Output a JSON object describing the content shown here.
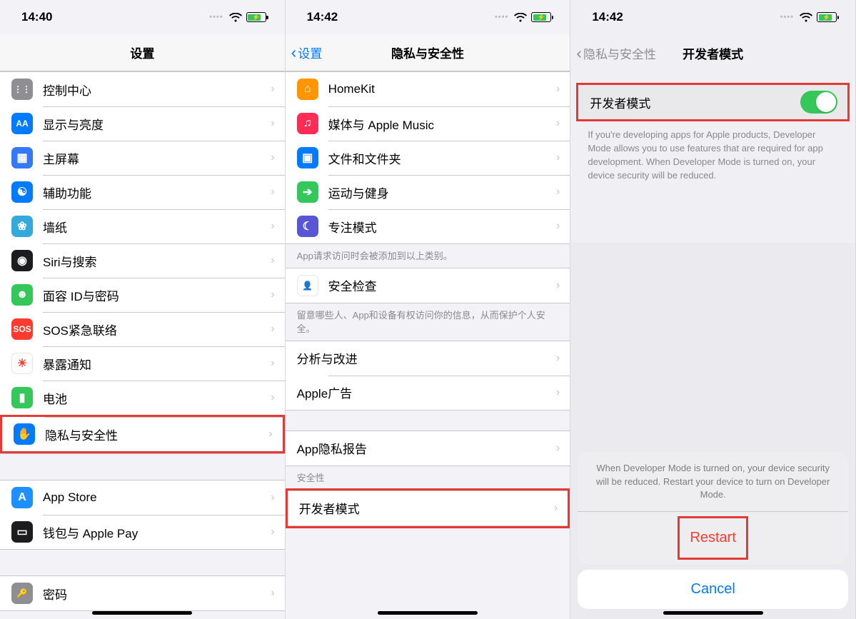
{
  "pane1": {
    "status_time": "14:40",
    "nav_title": "设置",
    "groups": [
      {
        "type": "cells",
        "cells": [
          {
            "icon": "control-center-icon",
            "bg": "bg-gray",
            "glyph": "⋮⋮",
            "label": "控制中心"
          },
          {
            "icon": "display-icon",
            "bg": "bg-blue",
            "glyph": "AA",
            "label": "显示与亮度"
          },
          {
            "icon": "home-screen-icon",
            "bg": "bg-apps",
            "glyph": "▦",
            "label": "主屏幕"
          },
          {
            "icon": "accessibility-icon",
            "bg": "bg-access",
            "glyph": "☯",
            "label": "辅助功能"
          },
          {
            "icon": "wallpaper-icon",
            "bg": "bg-wall",
            "glyph": "❀",
            "label": "墙纸"
          },
          {
            "icon": "siri-icon",
            "bg": "bg-siri",
            "glyph": "◉",
            "label": "Siri与搜索"
          },
          {
            "icon": "faceid-icon",
            "bg": "bg-faceid",
            "glyph": "☻",
            "label": "面容 ID与密码"
          },
          {
            "icon": "sos-icon",
            "bg": "bg-sos",
            "glyph": "SOS",
            "label": "SOS紧急联络"
          },
          {
            "icon": "exposure-icon",
            "bg": "bg-expose",
            "glyph": "☀",
            "label": "暴露通知"
          },
          {
            "icon": "battery-icon",
            "bg": "bg-battery",
            "glyph": "▮",
            "label": "电池"
          },
          {
            "icon": "privacy-icon",
            "bg": "bg-privacy",
            "glyph": "✋",
            "label": "隐私与安全性",
            "highlight": true
          }
        ]
      },
      {
        "type": "gap"
      },
      {
        "type": "cells",
        "cells": [
          {
            "icon": "appstore-icon",
            "bg": "bg-appstore",
            "glyph": "A",
            "label": "App Store"
          },
          {
            "icon": "wallet-icon",
            "bg": "bg-wallet",
            "glyph": "▭",
            "label": "钱包与 Apple Pay"
          }
        ]
      },
      {
        "type": "gap"
      },
      {
        "type": "cells",
        "cells": [
          {
            "icon": "passwords-icon",
            "bg": "bg-passwords",
            "glyph": "🔑",
            "label": "密码"
          }
        ]
      }
    ]
  },
  "pane2": {
    "status_time": "14:42",
    "nav_back": "设置",
    "nav_title": "隐私与安全性",
    "sections": [
      {
        "type": "cells",
        "cells": [
          {
            "icon": "homekit-icon",
            "bg": "bg-orange",
            "glyph": "⌂",
            "label": "HomeKit"
          },
          {
            "icon": "music-icon",
            "bg": "bg-red",
            "glyph": "♫",
            "label": "媒体与 Apple Music"
          },
          {
            "icon": "files-icon",
            "bg": "bg-folder",
            "glyph": "▣",
            "label": "文件和文件夹"
          },
          {
            "icon": "fitness-icon",
            "bg": "bg-health",
            "glyph": "➔",
            "label": "运动与健身"
          },
          {
            "icon": "focus-icon",
            "bg": "bg-focus",
            "glyph": "☾",
            "label": "专注模式"
          }
        ],
        "footer": "App请求访问时会被添加到以上类别。"
      },
      {
        "type": "cells",
        "cells": [
          {
            "icon": "safety-check-icon",
            "bg": "bg-safetycheck",
            "glyph": "👤",
            "label": "安全检查"
          }
        ],
        "footer": "留意哪些人、App和设备有权访问你的信息，从而保护个人安全。"
      },
      {
        "type": "cells-noicon",
        "cells": [
          {
            "label": "分析与改进"
          },
          {
            "label": "Apple广告"
          }
        ]
      },
      {
        "type": "gap"
      },
      {
        "type": "cells-noicon",
        "cells": [
          {
            "label": "App隐私报告"
          }
        ]
      },
      {
        "type": "header",
        "text": "安全性"
      },
      {
        "type": "cells-noicon",
        "highlight": true,
        "cells": [
          {
            "label": "开发者模式"
          }
        ]
      }
    ]
  },
  "pane3": {
    "status_time": "14:42",
    "nav_back": "隐私与安全性",
    "nav_title": "开发者模式",
    "toggle_label": "开发者模式",
    "footer_text": "If you're developing apps for Apple products, Developer Mode allows you to use features that are required for app development. When Developer Mode is turned on, your device security will be reduced.",
    "sheet_msg": "When Developer Mode is turned on, your device security will be reduced. Restart your device to turn on Developer Mode.",
    "restart_label": "Restart",
    "cancel_label": "Cancel"
  }
}
